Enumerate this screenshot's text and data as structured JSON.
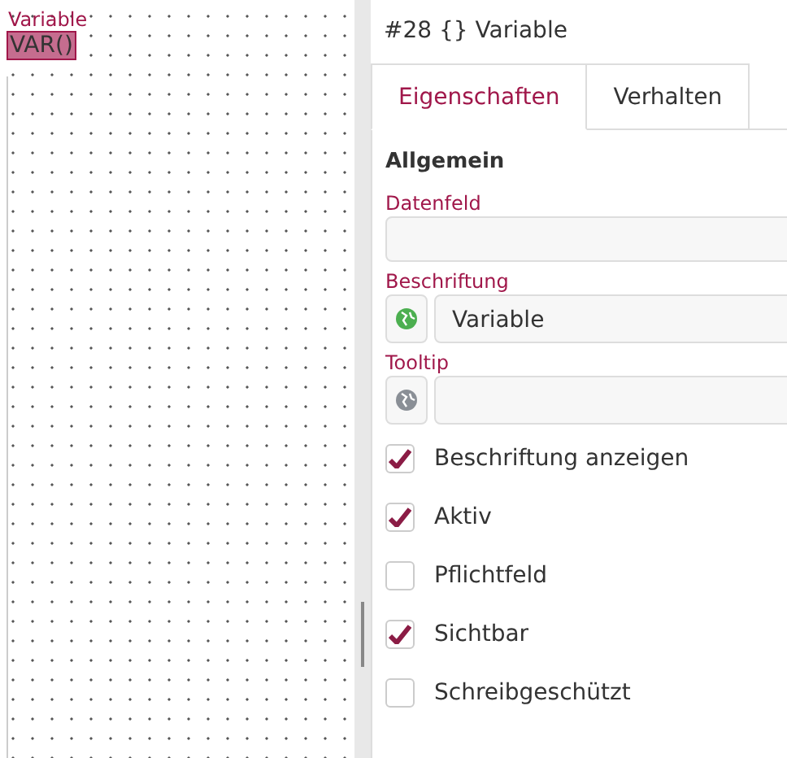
{
  "canvas": {
    "element_label": "Variable",
    "element_value": "VAR()"
  },
  "panel": {
    "title": "#28 {} Variable"
  },
  "tabs": [
    {
      "label": "Eigenschaften",
      "selected": true
    },
    {
      "label": "Verhalten",
      "selected": false
    }
  ],
  "section": "Allgemein",
  "fields": [
    {
      "label": "Datenfeld",
      "kind": "plain"
    },
    {
      "label": "Beschriftung",
      "kind": "translatable",
      "translated": true,
      "value": "Variable"
    },
    {
      "label": "Tooltip",
      "kind": "translatable",
      "translated": false
    }
  ],
  "options": [
    {
      "label": "Beschriftung anzeigen",
      "checked": true
    },
    {
      "label": "Aktiv",
      "checked": true
    },
    {
      "label": "Pflichtfeld",
      "checked": false
    },
    {
      "label": "Sichtbar",
      "checked": true
    },
    {
      "label": "Schreibgeschützt",
      "checked": false
    }
  ]
}
